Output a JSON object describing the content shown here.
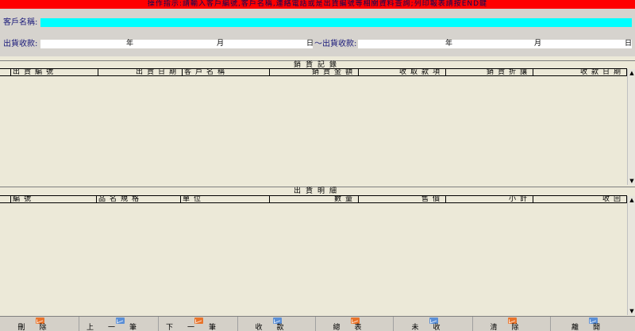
{
  "instruction": "操作指示:請輸入客戶編號,客戶名稱,連絡電話或是出貨編號等相關資料查詢;列印報表請按END鍵",
  "filter": {
    "customer_label": "客戶名稱:",
    "customer_value": "",
    "date_label": "出貨收款:",
    "date_to_label": "～出貨收款:",
    "year": "年",
    "month": "月",
    "day": "日"
  },
  "sales": {
    "title": "銷貨記錄",
    "columns": [
      "出貨編號",
      "出貨日期",
      "客戶名稱",
      "銷貨金額",
      "收取款項",
      "銷貨折讓",
      "收款日期"
    ]
  },
  "details": {
    "title": "出貨明細",
    "columns": [
      "編號",
      "品名規格",
      "單位",
      "數量",
      "售價",
      "小計",
      "收回"
    ]
  },
  "toolbar": {
    "buttons": [
      {
        "label": "刪除",
        "color": "#e8742c"
      },
      {
        "label": "上一筆",
        "color": "#5b8fd6"
      },
      {
        "label": "下一筆",
        "color": "#e8742c"
      },
      {
        "label": "收款",
        "color": "#5b8fd6"
      },
      {
        "label": "總表",
        "color": "#e8742c"
      },
      {
        "label": "未收",
        "color": "#5b8fd6"
      },
      {
        "label": "清除",
        "color": "#e8742c"
      },
      {
        "label": "離開",
        "color": "#5b8fd6"
      }
    ]
  }
}
